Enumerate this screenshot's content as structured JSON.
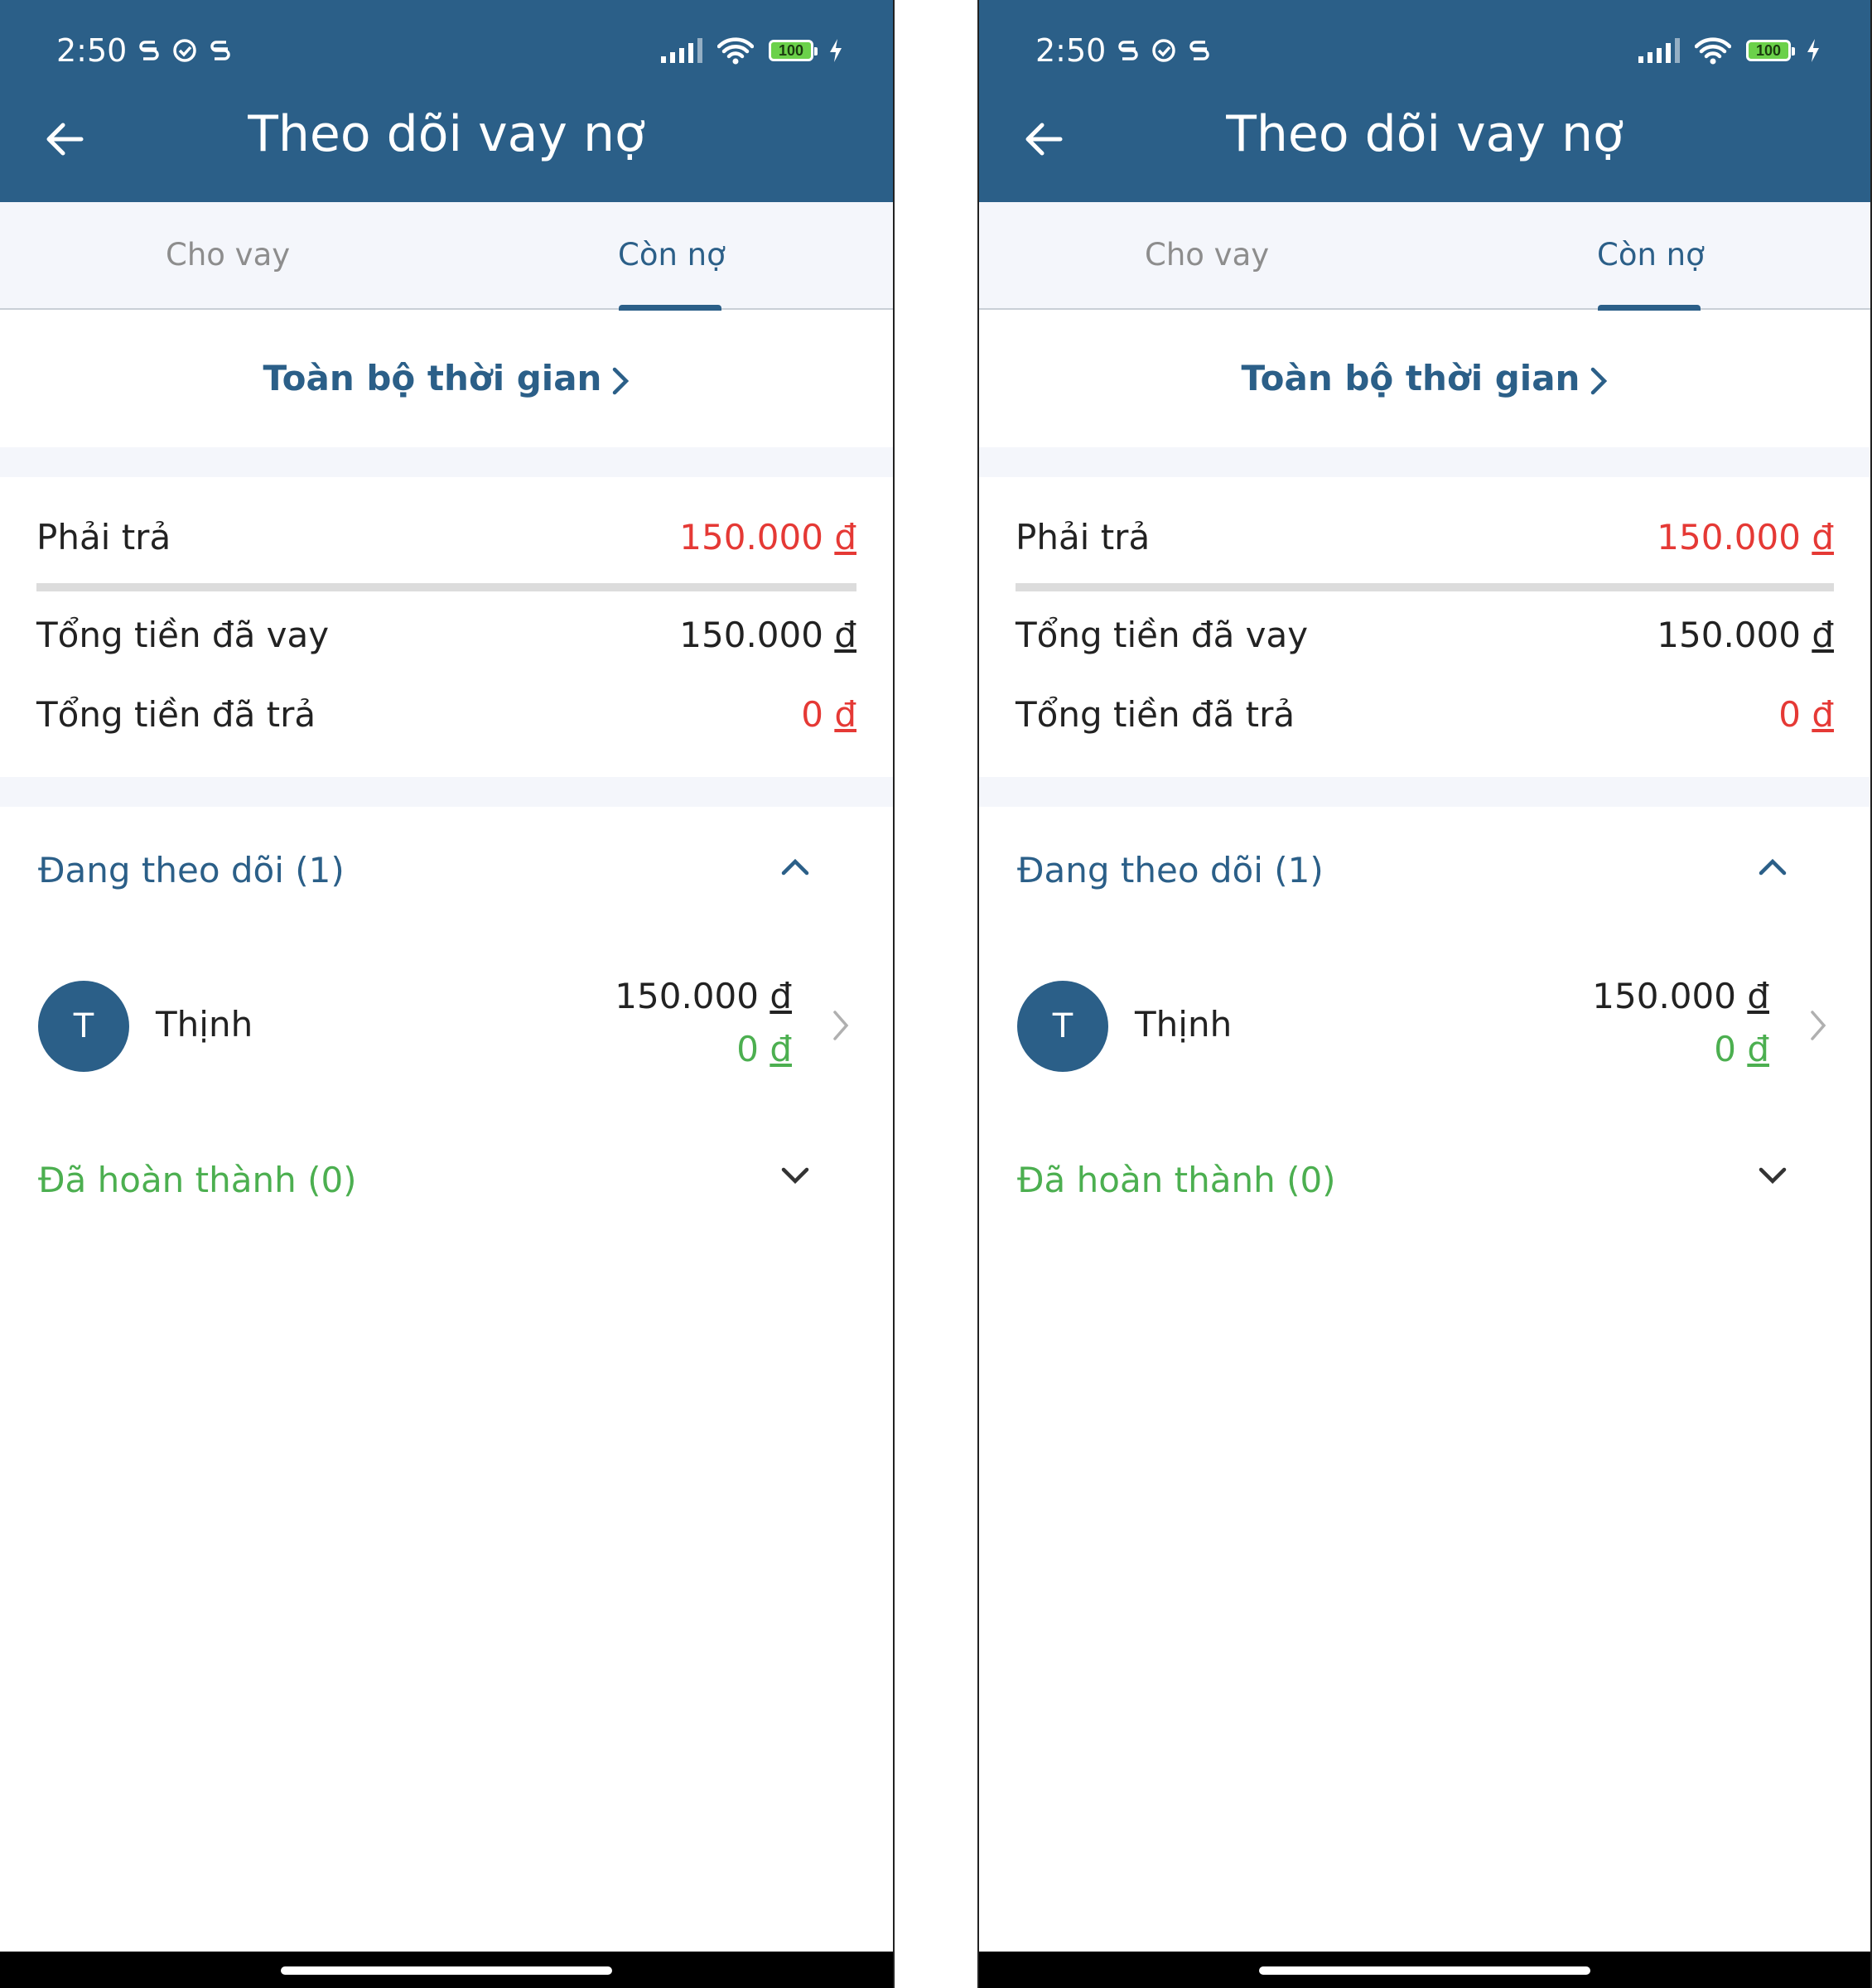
{
  "status_bar": {
    "time": "2:50",
    "battery": "100"
  },
  "header": {
    "title": "Theo dõi vay nợ"
  },
  "tabs": [
    {
      "label": "Cho vay",
      "active": false
    },
    {
      "label": "Còn nợ",
      "active": true
    }
  ],
  "period": {
    "label": "Toàn bộ thời gian"
  },
  "summary": {
    "must_pay": {
      "label": "Phải trả",
      "value": "150.000",
      "currency": "đ"
    },
    "total_borrowed": {
      "label": "Tổng tiền đã vay",
      "value": "150.000",
      "currency": "đ"
    },
    "total_paid": {
      "label": "Tổng tiền đã trả",
      "value": "0",
      "currency": "đ"
    }
  },
  "tracking": {
    "label": "Đang theo dõi (1)",
    "items": [
      {
        "initial": "T",
        "name": "Thịnh",
        "amount": "150.000",
        "paid": "0",
        "currency": "đ"
      }
    ]
  },
  "completed": {
    "label": "Đã hoàn thành (0)"
  },
  "colors": {
    "primary": "#2b5f88",
    "red": "#e53935",
    "green": "#4caf50",
    "tab_bg": "#f4f6fb"
  }
}
